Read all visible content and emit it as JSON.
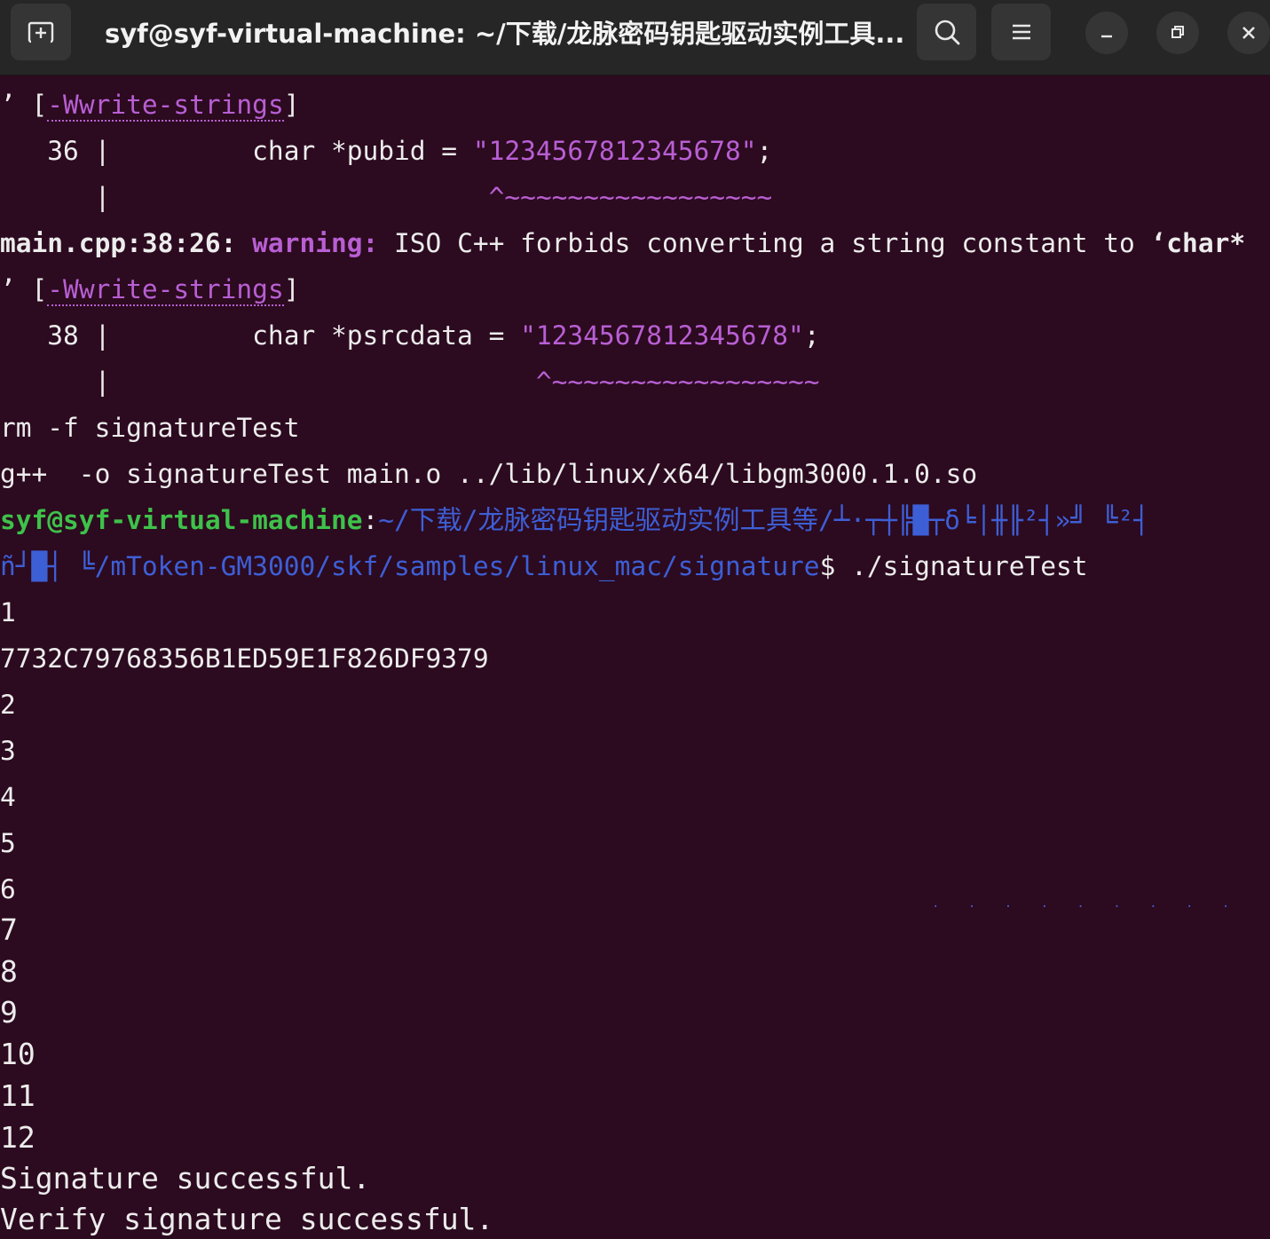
{
  "window": {
    "title": "syf@syf-virtual-machine: ~/下载/龙脉密码钥匙驱动实例工具..."
  },
  "toolbar": {
    "new_tab_icon": "new-tab-icon",
    "search_icon": "search-icon",
    "menu_icon": "hamburger-menu-icon",
    "minimize_icon": "minimize-icon",
    "maximize_icon": "restore-icon",
    "close_icon": "close-icon"
  },
  "terminal": {
    "l1_quote": "’ [",
    "l1_flag": "-Wwrite-strings",
    "l1_end": "]",
    "l2_gutter": "   36 |         ",
    "l2_code": "char *pubid = ",
    "l2_string": "\"1234567812345678\"",
    "l2_semicolon": ";",
    "l3_gutter": "      |                        ",
    "l3_caret": "^~~~~~~~~~~~~~~~~~",
    "l4_file": "main.cpp:38:26: ",
    "l4_warning": "warning:",
    "l4_msg": " ISO C++ forbids converting a string constant to ",
    "l4_type": "‘char*",
    "l5_quote": "’ [",
    "l5_flag": "-Wwrite-strings",
    "l5_end": "]",
    "l6_gutter": "   38 |         ",
    "l6_code": "char *psrcdata = ",
    "l6_string": "\"1234567812345678\"",
    "l6_semicolon": ";",
    "l7_gutter": "      |                           ",
    "l7_caret": "^~~~~~~~~~~~~~~~~~",
    "l8": "rm -f signatureTest",
    "l9": "g++  -o signatureTest main.o ../lib/linux/x64/libgm3000.1.0.so",
    "prompt_user": "syf@syf-virtual-machine",
    "prompt_colon": ":",
    "prompt_path1": "~/下载/龙脉密码钥匙驱动实例工具等/┴·┬┼╠█┬δ╘│╫╟²┤»╝ ╚²┤",
    "prompt_path2_garble": "ñ┘█┤ ╚",
    "prompt_path2": "/mToken-GM3000/skf/samples/linux_mac/signature",
    "prompt_dollar": "$ ",
    "command": "./signatureTest",
    "out_1": "1",
    "out_hash": "7732C79768356B1ED59E1F826DF9379",
    "out_2": "2",
    "out_3": "3",
    "out_4": "4",
    "out_5": "5",
    "out_6": "6",
    "out_7": "7",
    "out_8": "8",
    "out_9": "9",
    "out_10": "10",
    "out_11": "11",
    "out_12": "12",
    "out_sig": "Signature successful.",
    "out_verify": "Verify signature successful."
  },
  "colors": {
    "background": "#2c0a1f",
    "titlebar": "#262626",
    "warning_magenta": "#b85fd4",
    "prompt_green": "#3ec24a",
    "path_blue": "#3d5fd6",
    "text": "#ececec"
  }
}
